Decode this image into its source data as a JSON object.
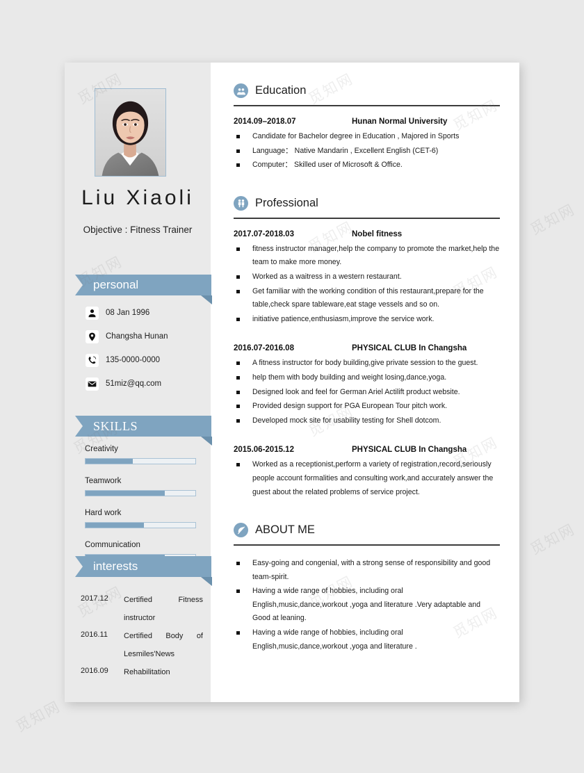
{
  "theme": {
    "accent": "#7fa4c0",
    "sidebar_bg": "#eaeaea",
    "page_bg": "#e9e9e9",
    "rule": "#3c3c3c"
  },
  "watermark": {
    "text": "觅知网"
  },
  "profile": {
    "name": "Liu Xiaoli",
    "objective": "Objective : Fitness Trainer",
    "photo_alt": "portrait-photo"
  },
  "sidebar": {
    "personal": {
      "banner": "personal",
      "items": [
        {
          "icon": "person-icon",
          "value": "08 Jan 1996"
        },
        {
          "icon": "location-pin-icon",
          "value": "Changsha Hunan"
        },
        {
          "icon": "phone-icon",
          "value": "135-0000-0000"
        },
        {
          "icon": "envelope-icon",
          "value": "51miz@qq.com"
        }
      ]
    },
    "skills": {
      "banner": "SKILLS",
      "items": [
        {
          "label": "Creativity",
          "percent": 43
        },
        {
          "label": "Teamwork",
          "percent": 72
        },
        {
          "label": "Hard work",
          "percent": 53
        },
        {
          "label": "Communication",
          "percent": 72
        }
      ]
    },
    "interests": {
      "banner": "interests",
      "items": [
        {
          "date": "2017.12",
          "desc": "Certified Fitness"
        },
        {
          "date": "",
          "desc": "instructor"
        },
        {
          "date": "2016.11",
          "desc": "Certified Body of"
        },
        {
          "date": "",
          "desc": "Lesmiles'News"
        },
        {
          "date": "2016.09",
          "desc": "Rehabilitation"
        }
      ]
    }
  },
  "main": {
    "education": {
      "icon": "graduation-people-icon",
      "title": "Education",
      "entries": [
        {
          "date": "2014.09–2018.07",
          "org": "Hunan Normal University",
          "bullets": [
            "Candidate for Bachelor degree in Education , Majored in Sports",
            "Language：  Native Mandarin , Excellent English (CET-6)",
            "Computer：  Skilled user of Microsoft & Office."
          ]
        }
      ]
    },
    "professional": {
      "icon": "two-people-icon",
      "title": "Professional",
      "entries": [
        {
          "date": "2017.07-2018.03",
          "org": "Nobel fitness",
          "bullets": [
            "fitness instructor manager,help the company to promote the market,help the team to make more money.",
            "Worked as a waitress in a western restaurant.",
            "Get familiar with the working condition of this restaurant,prepare for the table,check spare tableware,eat stage vessels and so on.",
            "initiative patience,enthusiasm,improve the service work."
          ]
        },
        {
          "date": "2016.07-2016.08",
          "org": "PHYSICAL CLUB In Changsha",
          "bullets": [
            "A fitness instructor for body building,give private session to the guest.",
            "help them with body building and weight losing,dance,yoga.",
            "Designed look and feel for German Ariel Actilift product website.",
            "Provided design support for PGA European Tour pitch work.",
            "Developed mock site for usability testing for Shell dotcom."
          ]
        },
        {
          "date": "2015.06-2015.12",
          "org": "PHYSICAL CLUB In Changsha",
          "bullets": [
            "Worked as a receptionist,perform a variety of registration,record,seriously people account formalities and consulting work,and accurately answer the guest about the related problems of service project."
          ]
        }
      ]
    },
    "about": {
      "icon": "feather-pen-icon",
      "title": "ABOUT ME",
      "bullets": [
        "Easy-going and congenial, with a strong sense of responsibility and good team-spirit.",
        "Having a wide range of hobbies, including oral English,music,dance,workout ,yoga and literature .Very adaptable and Good at leaning.",
        "Having a wide range of hobbies, including oral English,music,dance,workout ,yoga and literature ."
      ]
    }
  }
}
